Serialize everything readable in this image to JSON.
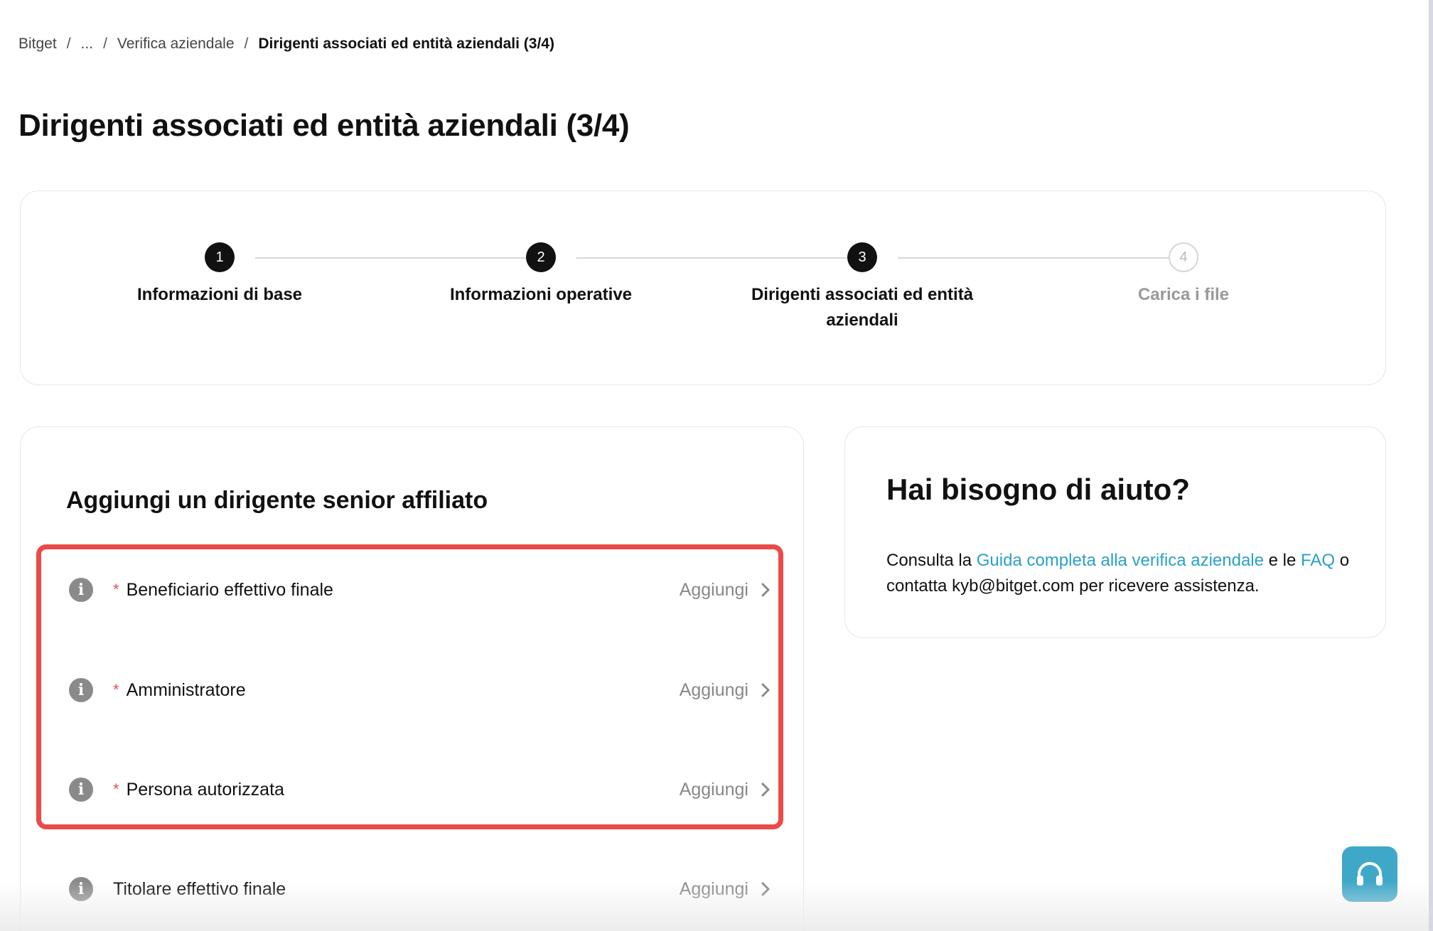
{
  "breadcrumb": {
    "items": [
      "Bitget",
      "...",
      "Verifica aziendale"
    ],
    "current": "Dirigenti associati ed entità aziendali (3/4)",
    "separator": "/"
  },
  "page_title": "Dirigenti associati ed entità aziendali (3/4)",
  "stepper": {
    "steps": [
      {
        "number": "1",
        "label": "Informazioni di base",
        "state": "done"
      },
      {
        "number": "2",
        "label": "Informazioni operative",
        "state": "done"
      },
      {
        "number": "3",
        "label": "Dirigenti associati ed entità aziendali",
        "state": "current"
      },
      {
        "number": "4",
        "label": "Carica i file",
        "state": "upcoming"
      }
    ]
  },
  "executives": {
    "title": "Aggiungi un dirigente senior affiliato",
    "action_label": "Aggiungi",
    "rows": [
      {
        "label": "Beneficiario effettivo finale",
        "required": true
      },
      {
        "label": "Amministratore",
        "required": true
      },
      {
        "label": "Persona autorizzata",
        "required": true
      },
      {
        "label": "Titolare effettivo finale",
        "required": false
      }
    ],
    "required_marker": "*",
    "info_glyph": "i"
  },
  "help": {
    "title": "Hai bisogno di aiuto?",
    "text_1": "Consulta la ",
    "link_guide": "Guida completa alla verifica aziendale",
    "text_2": " e le ",
    "link_faq": "FAQ",
    "text_3": " o contatta kyb@bitget.com per ricevere assistenza."
  },
  "colors": {
    "accent_link": "#2aa0c8",
    "highlight_border": "#ea4a4a",
    "support_button": "#3fa8c9",
    "required_star": "#e0505a"
  },
  "icons": {
    "info": "info-icon",
    "chevron": "chevron-right-icon",
    "support": "headset-icon"
  }
}
